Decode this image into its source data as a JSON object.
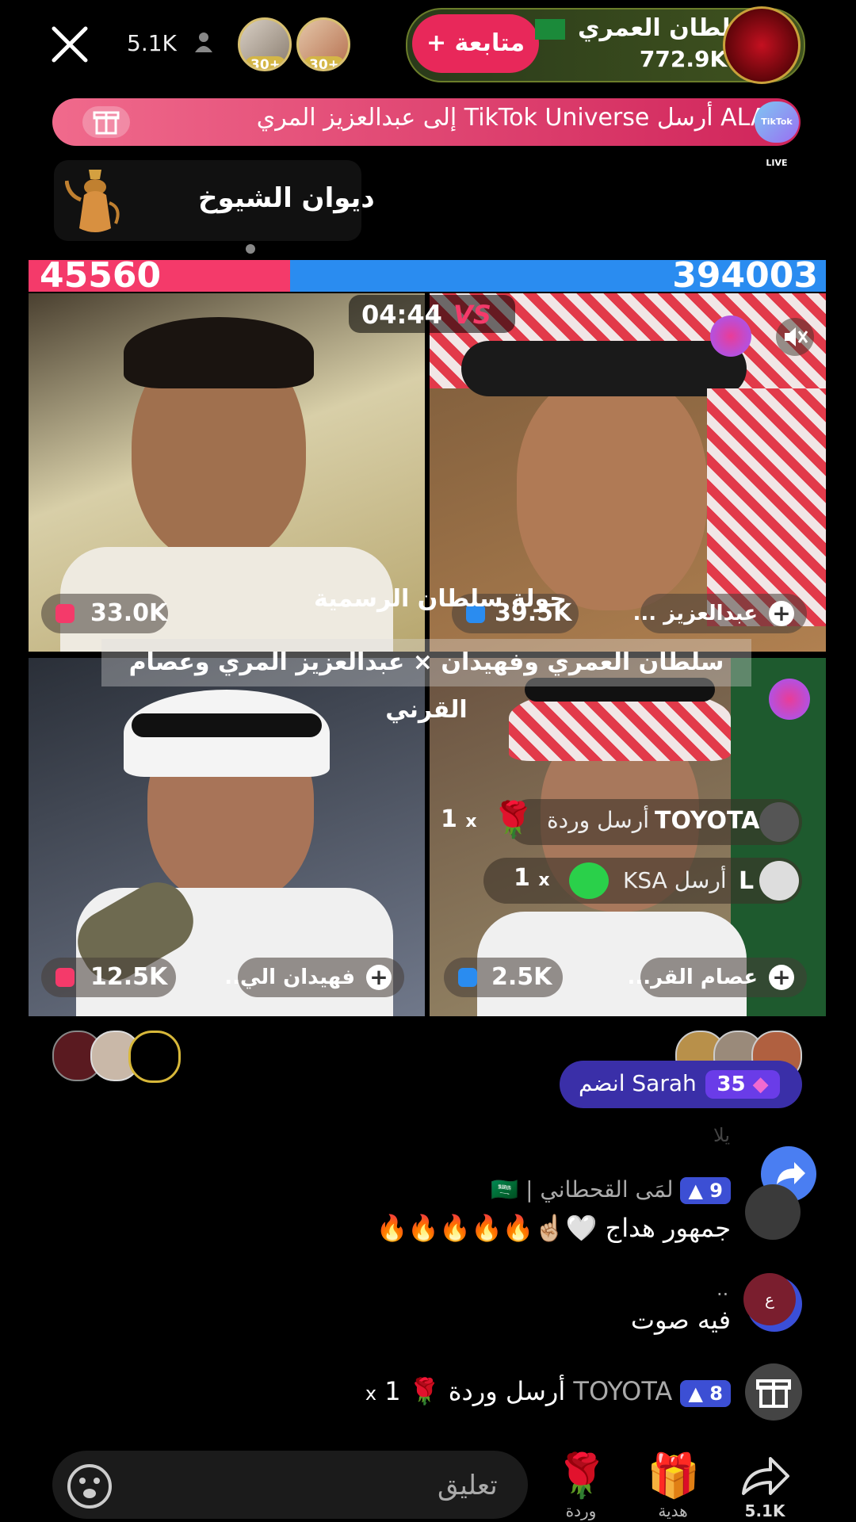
{
  "top_bar": {
    "viewer_count": "5.1K",
    "avatar_badges": [
      "30+",
      "30+"
    ],
    "follow_label": "+ متابعة",
    "host_name": "سلطان العمري",
    "host_likes": "772.9K"
  },
  "gift_banner": {
    "text": "ALAN أرسل TikTok Universe إلى عبدالعزيز المري",
    "tiktok_live_label": "TikTok LIVE"
  },
  "diwan": {
    "title": "ديوان الشيوخ"
  },
  "battle": {
    "score_left": "45560",
    "score_right": "394003",
    "timer": "04:44",
    "vs_label": "VS",
    "overlay_title": "جولة  سلطان  الرسمية",
    "overlay_subtitle": "سلطان العمري  وفهيدان  ×  عبدالعزيز  المري  وعصام  القرني",
    "tiles": [
      {
        "score": "33.0K",
        "name": ""
      },
      {
        "score": "39.5K",
        "name": "عبدالعزيز ..."
      },
      {
        "score": "12.5K",
        "name": "فهيدان الي.."
      },
      {
        "score": "2.5K",
        "name": "عصام القر..."
      }
    ],
    "gift_notices": [
      {
        "user": "TOYOTA",
        "text": "أرسل وردة",
        "count": "1",
        "times": "x"
      },
      {
        "user": "L",
        "text": "أرسل KSA",
        "count": "1",
        "times": "x"
      }
    ]
  },
  "join_notice": {
    "level": "35",
    "text": "Sarah انضم"
  },
  "chat": [
    {
      "level": "9",
      "user": "لمَى القحطاني |",
      "flag": "🇸🇦",
      "message": "جمهور هداج 🤍☝🏼🔥🔥🔥🔥🔥"
    },
    {
      "user": "..",
      "message": "فيه صوت",
      "avatar_letter": "ع"
    },
    {
      "level": "8",
      "user": "TOYOTA",
      "message": "أرسل وردة",
      "times": "x",
      "count": "1"
    }
  ],
  "chat_partial": "يلا",
  "bottom_bar": {
    "comment_placeholder": "تعليق",
    "rose_label": "وردة",
    "gift_label": "هدية",
    "share_count": "5.1K"
  },
  "colors": {
    "follow_pink": "#e8285a",
    "score_red": "#f43a6a",
    "score_blue": "#2a8cf0",
    "level_badge": "#3c4fd4"
  }
}
